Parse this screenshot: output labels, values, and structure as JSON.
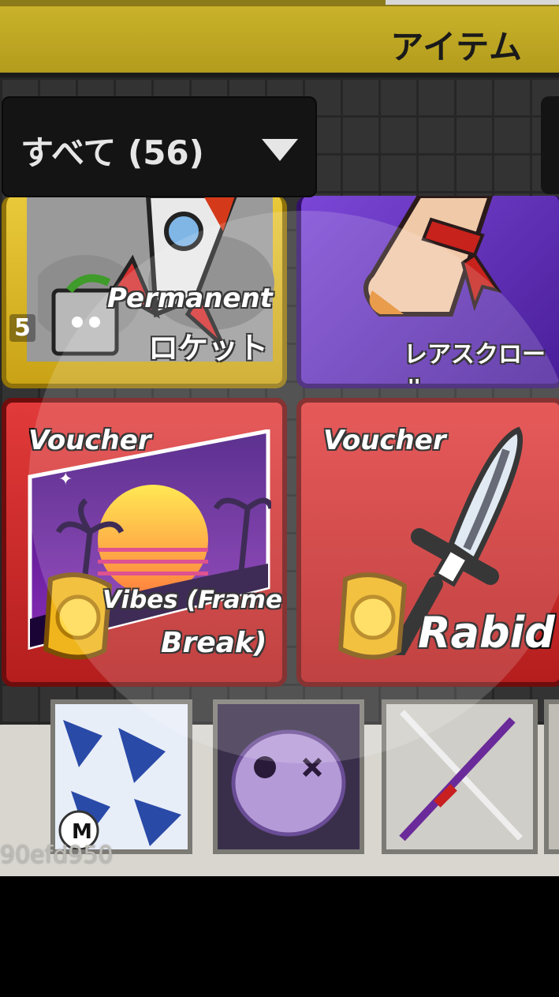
{
  "header": {
    "title": "アイテム"
  },
  "filter": {
    "label": "すべて (56)"
  },
  "cards": [
    {
      "tag": "Permanent",
      "name": "ロケット",
      "count": "5"
    },
    {
      "tag": "",
      "name": "レアスクロール"
    },
    {
      "tag": "Voucher",
      "name_line1": "Vibes (Frame",
      "name_line2": "Break)"
    },
    {
      "tag": "Voucher",
      "name": "Rabid"
    }
  ],
  "bottom": {
    "uid": "90efd950",
    "slot_badge": "M"
  },
  "icons": [
    "rocket-icon",
    "scroll-icon",
    "sunset-frame-icon",
    "sword-icon",
    "gold-coin-icon",
    "chevron-down-icon"
  ]
}
